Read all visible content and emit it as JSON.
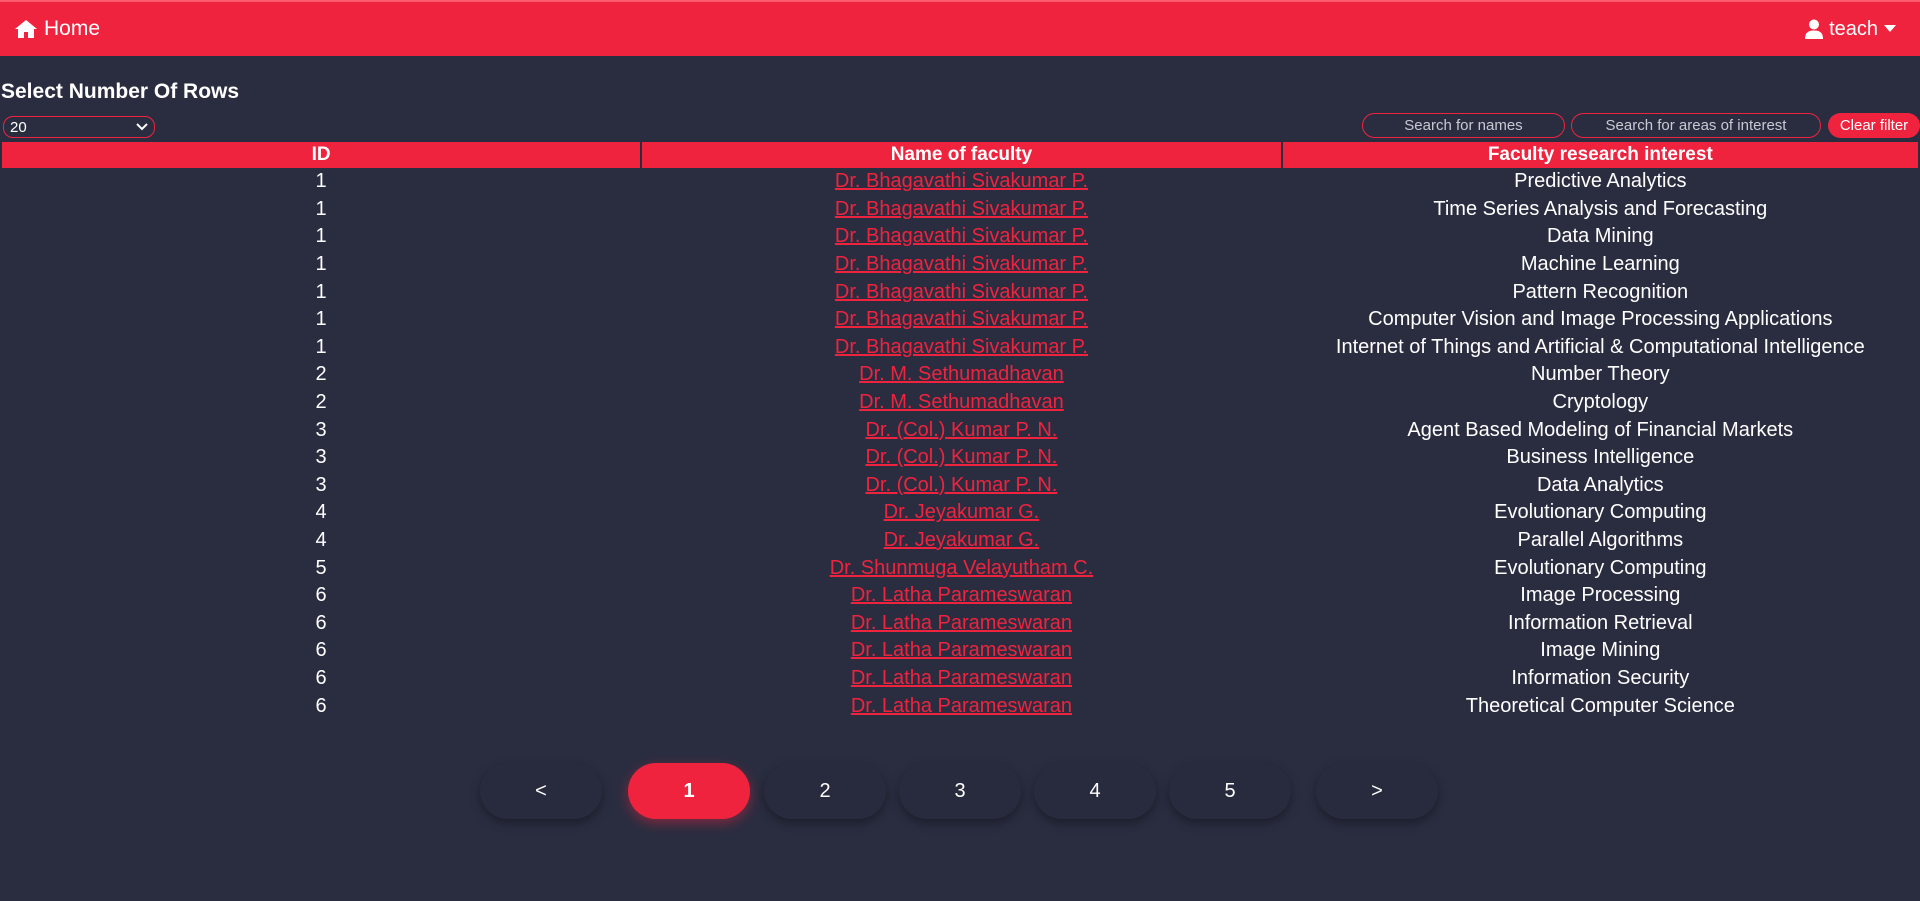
{
  "nav": {
    "home_label": "Home",
    "user_label": "teach"
  },
  "rows_selector": {
    "title": "Select Number Of Rows",
    "selected": "20"
  },
  "filters": {
    "names_placeholder": "Search for names",
    "areas_placeholder": "Search for areas of interest",
    "clear_label": "Clear filter"
  },
  "table": {
    "headers": [
      "ID",
      "Name of faculty",
      "Faculty research interest"
    ],
    "rows": [
      {
        "id": "1",
        "name": "Dr. Bhagavathi Sivakumar P.",
        "interest": "Predictive Analytics"
      },
      {
        "id": "1",
        "name": "Dr. Bhagavathi Sivakumar P.",
        "interest": "Time Series Analysis and Forecasting"
      },
      {
        "id": "1",
        "name": "Dr. Bhagavathi Sivakumar P.",
        "interest": "Data Mining"
      },
      {
        "id": "1",
        "name": "Dr. Bhagavathi Sivakumar P.",
        "interest": "Machine Learning"
      },
      {
        "id": "1",
        "name": "Dr. Bhagavathi Sivakumar P.",
        "interest": "Pattern Recognition"
      },
      {
        "id": "1",
        "name": "Dr. Bhagavathi Sivakumar P.",
        "interest": "Computer Vision and Image Processing Applications"
      },
      {
        "id": "1",
        "name": "Dr. Bhagavathi Sivakumar P.",
        "interest": "Internet of Things and Artificial & Computational Intelligence"
      },
      {
        "id": "2",
        "name": "Dr. M. Sethumadhavan",
        "interest": "Number Theory"
      },
      {
        "id": "2",
        "name": "Dr. M. Sethumadhavan",
        "interest": "Cryptology"
      },
      {
        "id": "3",
        "name": "Dr. (Col.) Kumar P. N.",
        "interest": "Agent Based Modeling of Financial Markets"
      },
      {
        "id": "3",
        "name": "Dr. (Col.) Kumar P. N.",
        "interest": "Business Intelligence"
      },
      {
        "id": "3",
        "name": "Dr. (Col.) Kumar P. N.",
        "interest": "Data Analytics"
      },
      {
        "id": "4",
        "name": "Dr. Jeyakumar G.",
        "interest": "Evolutionary Computing"
      },
      {
        "id": "4",
        "name": "Dr. Jeyakumar G.",
        "interest": "Parallel Algorithms"
      },
      {
        "id": "5",
        "name": "Dr. Shunmuga Velayutham C.",
        "interest": "Evolutionary Computing"
      },
      {
        "id": "6",
        "name": "Dr. Latha Parameswaran",
        "interest": "Image Processing"
      },
      {
        "id": "6",
        "name": "Dr. Latha Parameswaran",
        "interest": "Information Retrieval"
      },
      {
        "id": "6",
        "name": "Dr. Latha Parameswaran",
        "interest": "Image Mining"
      },
      {
        "id": "6",
        "name": "Dr. Latha Parameswaran",
        "interest": "Information Security"
      },
      {
        "id": "6",
        "name": "Dr. Latha Parameswaran",
        "interest": "Theoretical Computer Science"
      }
    ]
  },
  "pagination": {
    "prev": "<",
    "pages": [
      "1",
      "2",
      "3",
      "4",
      "5"
    ],
    "next": ">",
    "current": "1"
  },
  "colors": {
    "accent": "#f0233f",
    "background": "#2a2d40"
  }
}
